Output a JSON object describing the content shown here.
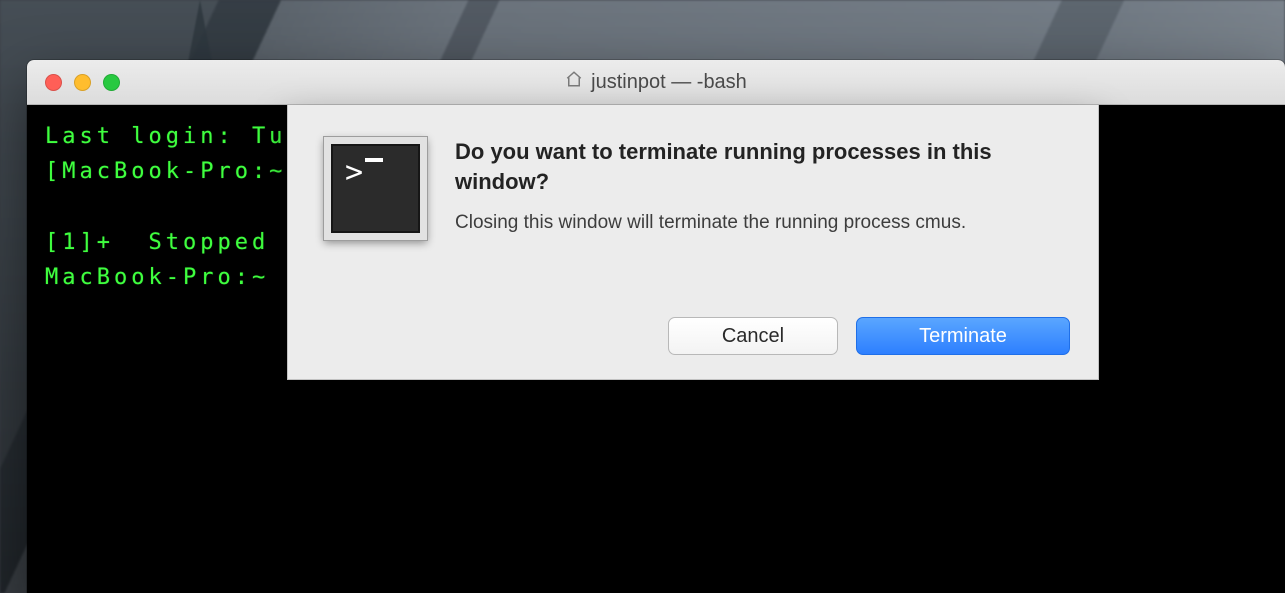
{
  "window": {
    "title": "justinpot — -bash"
  },
  "terminal": {
    "line1": "Last login: Tue",
    "line2": "[MacBook-Pro:~ j",
    "line3": "",
    "line4": "[1]+  Stopped",
    "line5": "MacBook-Pro:~ j"
  },
  "dialog": {
    "headline": "Do you want to terminate running processes in this window?",
    "message": "Closing this window will terminate the running process cmus.",
    "cancel_label": "Cancel",
    "confirm_label": "Terminate"
  }
}
